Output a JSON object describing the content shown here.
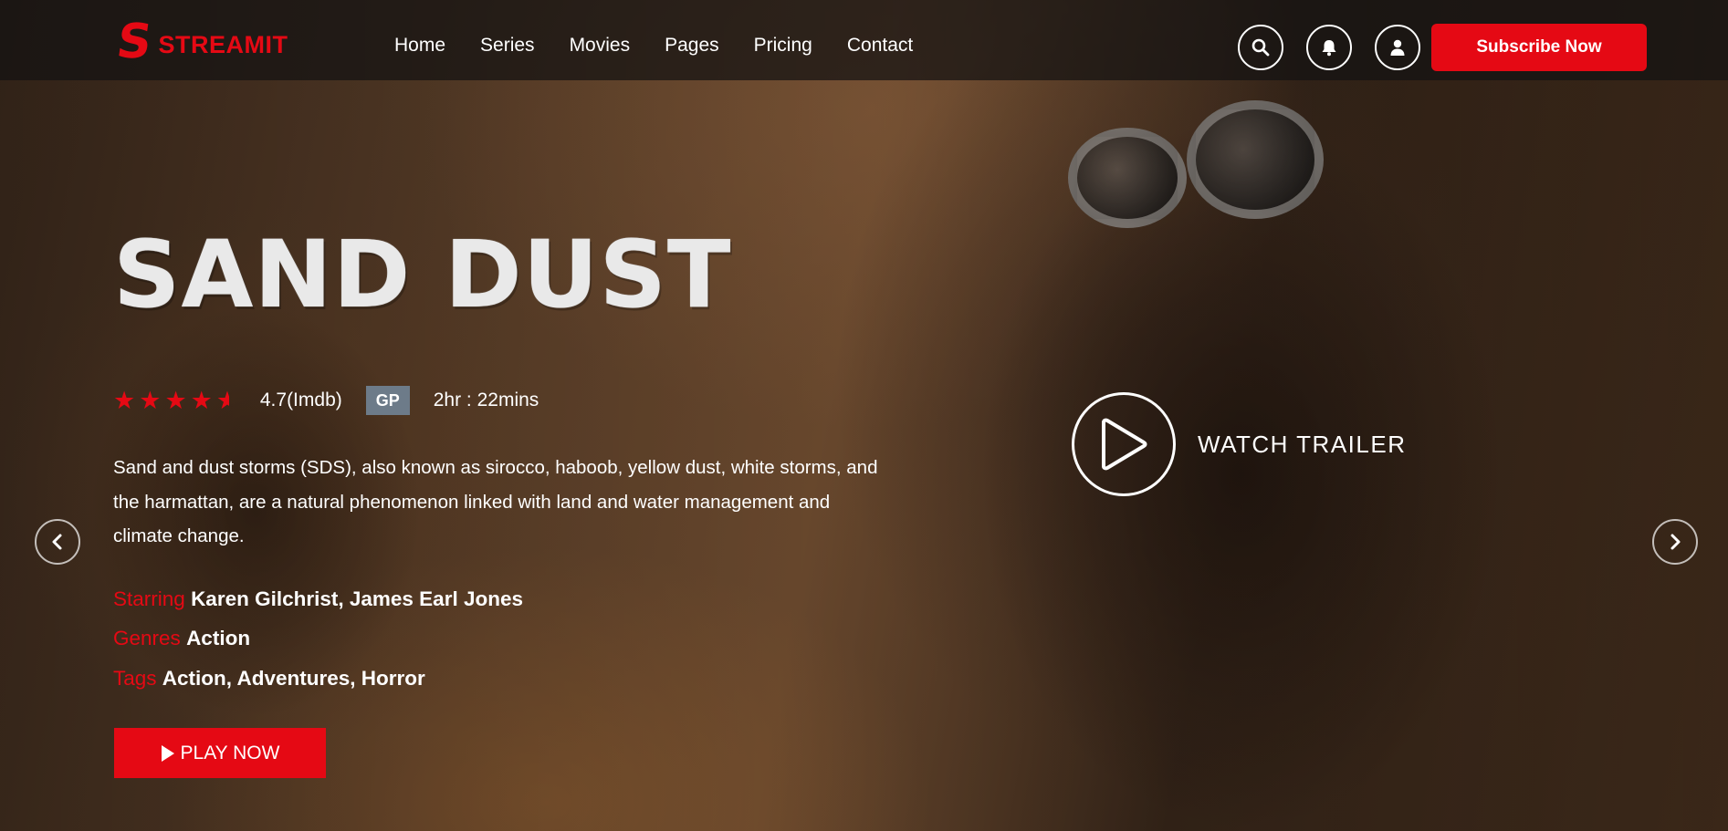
{
  "brand": {
    "logo_mark": "S",
    "name": "STREAMIT"
  },
  "nav": {
    "items": [
      {
        "label": "Home"
      },
      {
        "label": "Series"
      },
      {
        "label": "Movies"
      },
      {
        "label": "Pages"
      },
      {
        "label": "Pricing"
      },
      {
        "label": "Contact"
      }
    ]
  },
  "header_actions": {
    "icons": [
      "search-icon",
      "bell-icon",
      "user-icon"
    ],
    "subscribe_label": "Subscribe Now"
  },
  "movie": {
    "title": "SAND DUST",
    "stars": 4.5,
    "rating_text": "4.7(Imdb)",
    "badge": "GP",
    "duration": "2hr : 22mins",
    "description": "Sand and dust storms (SDS), also known as sirocco, haboob, yellow dust, white storms, and the harmattan, are a natural phenomenon linked with land and water management and climate change.",
    "starring_label": "Starring",
    "starring": "Karen Gilchrist, James Earl Jones",
    "genres_label": "Genres",
    "genres": "Action",
    "tags_label": "Tags",
    "tags": "Action, Adventures, Horror",
    "play_label": "PLAY NOW",
    "trailer_label": "WATCH TRAILER"
  },
  "colors": {
    "accent": "#e50914",
    "badge": "#6d7b89"
  }
}
